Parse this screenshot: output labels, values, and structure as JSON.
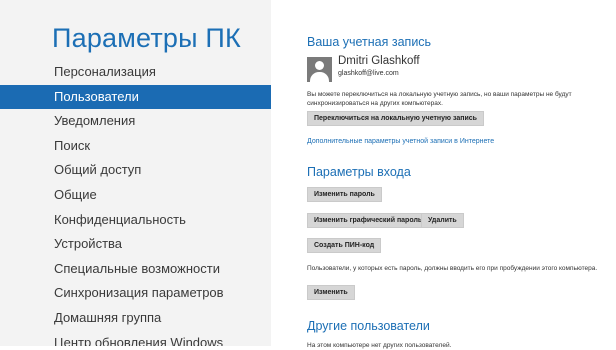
{
  "sidebar": {
    "title": "Параметры ПК",
    "items": [
      {
        "label": "Персонализация"
      },
      {
        "label": "Пользователи"
      },
      {
        "label": "Уведомления"
      },
      {
        "label": "Поиск"
      },
      {
        "label": "Общий доступ"
      },
      {
        "label": "Общие"
      },
      {
        "label": "Конфиденциальность"
      },
      {
        "label": "Устройства"
      },
      {
        "label": "Специальные возможности"
      },
      {
        "label": "Синхронизация параметров"
      },
      {
        "label": "Домашняя группа"
      },
      {
        "label": "Центр обновления Windows"
      }
    ],
    "selected": "Пользователи"
  },
  "account": {
    "heading": "Ваша учетная запись",
    "user_name": "Dmitri Glashkoff",
    "user_email": "glashkoff@live.com",
    "description": "Вы можете переключиться на локальную учетную запись, но ваши параметры не будут синхронизироваться на других компьютерах.",
    "switch_button": "Переключиться на локальную учетную запись",
    "more_link": "Дополнительные параметры учетной записи в Интернете"
  },
  "signin": {
    "heading": "Параметры входа",
    "change_password": "Изменить пароль",
    "change_picture_password": "Изменить графический пароль",
    "delete": "Удалить",
    "create_pin": "Создать ПИН-код",
    "wake_text": "Пользователи, у которых есть пароль, должны вводить его при пробуждении этого компьютера.",
    "change": "Изменить"
  },
  "others": {
    "heading": "Другие пользователи",
    "partial_text": "На этом компьютере нет других пользователей."
  }
}
